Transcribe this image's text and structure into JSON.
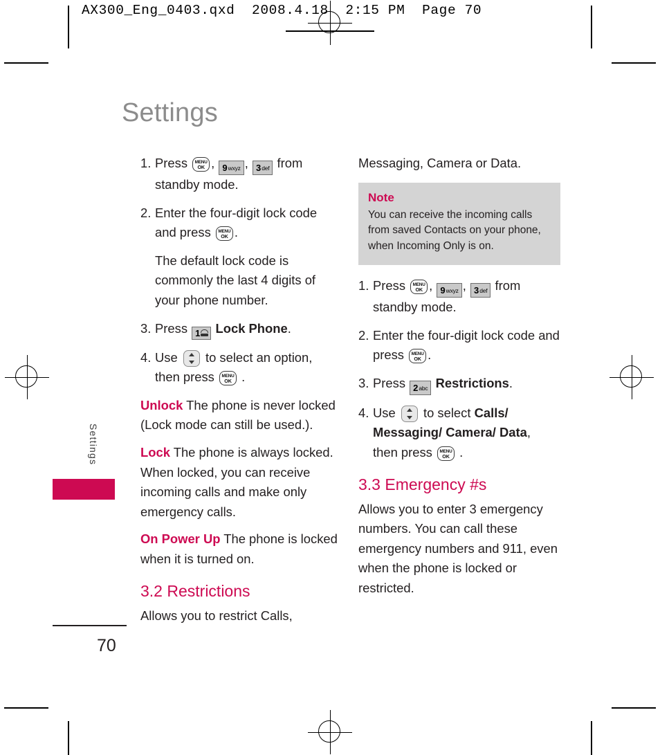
{
  "slug": "AX300_Eng_0403.qxd  2008.4.18  2:15 PM  Page 70",
  "page_title": "Settings",
  "side_tab_label": "Settings",
  "page_number": "70",
  "colors": {
    "accent": "#cd0a52",
    "title_gray": "#8c8c8c",
    "note_bg": "#d4d4d4",
    "body": "#231f20"
  },
  "keys": {
    "menu_ok_line1": "MENU",
    "menu_ok_line2": "OK",
    "k9_digit": "9",
    "k9_sub": "wxyz",
    "k3_digit": "3",
    "k3_sub": "def",
    "k1_digit": "1",
    "k2_digit": "2",
    "k2_sub": "abc"
  },
  "left_column": {
    "steps": [
      {
        "num": "1.",
        "pre": "Press",
        "mid1": ",",
        "mid2": ",",
        "post": "from standby mode."
      },
      {
        "num": "2.",
        "pre": "Enter the four-digit lock code and press",
        "post": "."
      },
      {
        "num": "3.",
        "pre": "Press",
        "bold": "Lock Phone",
        "post": "."
      },
      {
        "num": "4.",
        "pre": "Use",
        "mid": "to select an option,",
        "then": "then press",
        "post": "."
      }
    ],
    "default_code_note": "The default lock code is commonly the last 4 digits of your phone number.",
    "definitions": [
      {
        "term": "Unlock",
        "text": " The phone is never locked (Lock mode can still be used.)."
      },
      {
        "term": "Lock",
        "text": " The phone is always locked. When locked, you can receive incoming calls and make only emergency calls."
      },
      {
        "term": "On Power Up",
        "text": " The phone is locked when it is turned on."
      }
    ],
    "section_heading": "3.2 Restrictions",
    "section_intro": "Allows you to restrict Calls,"
  },
  "right_column": {
    "intro_continued": "Messaging, Camera or Data.",
    "note": {
      "title": "Note",
      "body": "You can receive the incoming calls from saved Contacts on your phone, when Incoming Only is on."
    },
    "steps": [
      {
        "num": "1.",
        "pre": "Press",
        "mid1": ",",
        "mid2": ",",
        "post": "from standby mode."
      },
      {
        "num": "2.",
        "pre": "Enter the four-digit lock code and press",
        "post": "."
      },
      {
        "num": "3.",
        "pre": "Press",
        "bold": "Restrictions",
        "post": "."
      },
      {
        "num": "4.",
        "pre": "Use",
        "mid": "to select",
        "bold": "Calls/ Messaging/ Camera/ Data",
        "comma": ",",
        "then": "then press",
        "post": "."
      }
    ],
    "section_heading": "3.3 Emergency #s",
    "section_body": "Allows you to enter 3 emergency numbers. You can call these emergency numbers and 911, even when the phone is locked or restricted."
  }
}
